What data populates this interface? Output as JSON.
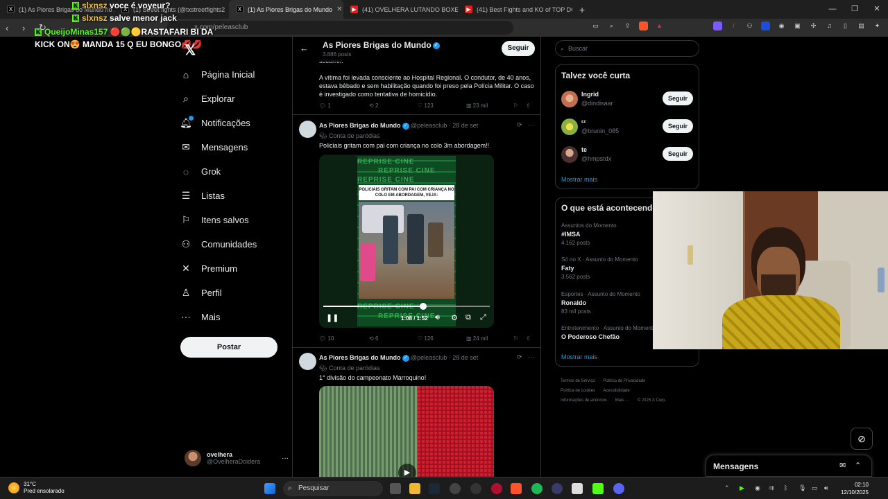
{
  "browser": {
    "tabs": [
      {
        "label": "(1) As Piores Brigas do Mundo no X",
        "icon": "x-favicon"
      },
      {
        "label": "(1) Street fights (@txstreetfights2",
        "icon": "x-favicon"
      },
      {
        "label": "(1) As Piores Brigas do Mundo",
        "icon": "x-favicon",
        "active": true
      },
      {
        "label": "(41) OVELHERA LUTANDO BOXE KKK",
        "icon": "youtube-favicon"
      },
      {
        "label": "(41) Best Fights and KO of TOP DOG",
        "icon": "youtube-favicon"
      }
    ],
    "address": "x.com/peleasclub"
  },
  "overlay_chat": [
    {
      "user": "slxnsz",
      "message": "voce é voyeur?"
    },
    {
      "user": "slxnsz",
      "message": "salve menor jack"
    },
    {
      "user": "QueijoMinas157",
      "message": "🔴🟢🟡RASTAFARI BI DA KICK ON😍 MANDA 15 Q EU BONGO💋💋"
    }
  ],
  "sidebar": {
    "items": [
      {
        "label": "Página Inicial",
        "icon": "home-icon"
      },
      {
        "label": "Explorar",
        "icon": "search-icon"
      },
      {
        "label": "Notificações",
        "icon": "bell-icon"
      },
      {
        "label": "Mensagens",
        "icon": "mail-icon"
      },
      {
        "label": "Grok",
        "icon": "grok-icon"
      },
      {
        "label": "Listas",
        "icon": "list-icon"
      },
      {
        "label": "Itens salvos",
        "icon": "bookmark-icon"
      },
      {
        "label": "Comunidades",
        "icon": "communities-icon"
      },
      {
        "label": "Premium",
        "icon": "x-icon"
      },
      {
        "label": "Perfil",
        "icon": "profile-icon"
      },
      {
        "label": "Mais",
        "icon": "more-circle-icon"
      }
    ],
    "post_label": "Postar",
    "account": {
      "name": "ovelhera",
      "handle": "@OvelheraDoidera"
    }
  },
  "profile_header": {
    "title": "As Piores Brigas do Mundo",
    "posts": "3.886 posts",
    "follow_label": "Seguir"
  },
  "prev_tweet": {
    "text1": "socorrer.",
    "text2": "A vítima foi levada consciente ao Hospital Regional. O condutor, de 40 anos, estava bêbado e sem habilitação quando foi preso pela Polícia Militar. O caso é investigado como tentativa de homicídio.",
    "replies": "1",
    "reposts": "2",
    "likes": "123",
    "views": "23 mil"
  },
  "tweet1": {
    "author": "As Piores Brigas do Mundo",
    "handle": "@peleasclub",
    "date": "· 28 de set",
    "label": "Conta de paródias",
    "text": "Policiais gritam com pai com criança no colo 3m abordagem!!",
    "video_caption": "POLICIAIS GRITAM COM PAI COM CRIANÇA NO COLO EM ABORDAGEM, VEJA:",
    "watermark": "REPRISE CINE",
    "time": "1:08 / 1:52",
    "progress": 0.6,
    "replies": "10",
    "reposts": "6",
    "likes": "126",
    "views": "24 mil"
  },
  "tweet2": {
    "author": "As Piores Brigas do Mundo",
    "handle": "@peleasclub",
    "date": "· 28 de set",
    "label": "Conta de paródias",
    "text": "1° divisão do campeonato Marroquino!"
  },
  "right": {
    "search_placeholder": "Buscar",
    "suggest_title": "Talvez você curta",
    "suggestions": [
      {
        "name": "Ingrid",
        "handle": "@dindisaar",
        "button": "Seguir"
      },
      {
        "name": "ᵋᶻ",
        "handle": "@brunin_085",
        "button": "Seguir"
      },
      {
        "name": "te",
        "handle": "@hmpstdx",
        "button": "Seguir"
      }
    ],
    "show_more": "Mostrar mais",
    "trends_title": "O que está acontecendo",
    "trends": [
      {
        "category": "Assuntos do Momento",
        "title": "#IMSA",
        "count": "4.162 posts"
      },
      {
        "category": "Só no X · Assunto do Momento",
        "title": "Faty",
        "count": "3.562 posts"
      },
      {
        "category": "Esportes · Assunto do Momento",
        "title": "Ronaldo",
        "count": "83 mil posts"
      },
      {
        "category": "Entretenimento · Assunto do Momento",
        "title": "O Poderoso Chefão",
        "count": ""
      }
    ],
    "trends_more": "Mostrar mais",
    "footer": [
      "Termos de Serviço",
      "Política de Privacidade",
      "Política de cookies",
      "Acessibilidade",
      "Informações de anúncios",
      "Mais ···",
      "© 2025 X Corp."
    ]
  },
  "messages_drawer": {
    "title": "Mensagens"
  },
  "taskbar": {
    "temp": "31°C",
    "weather": "Pred ensolarado",
    "search": "Pesquisar",
    "time": "02:10",
    "date": "12/10/2025"
  },
  "colors": {
    "accent": "#1d9bf0",
    "kick": "#53fc18",
    "background": "#000000"
  }
}
